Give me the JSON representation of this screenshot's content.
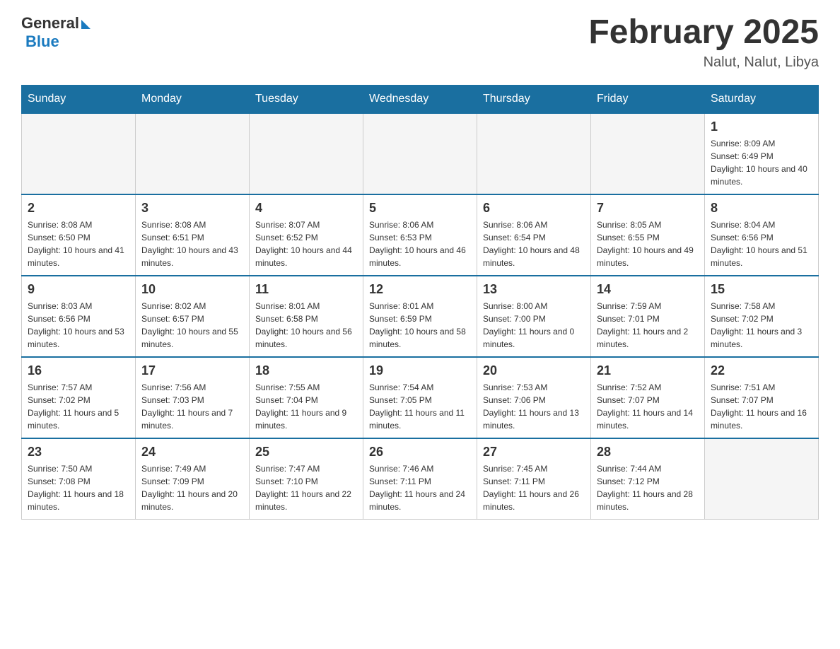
{
  "header": {
    "logo_general": "General",
    "logo_blue": "Blue",
    "month_title": "February 2025",
    "location": "Nalut, Nalut, Libya"
  },
  "weekdays": [
    "Sunday",
    "Monday",
    "Tuesday",
    "Wednesday",
    "Thursday",
    "Friday",
    "Saturday"
  ],
  "weeks": [
    [
      {
        "day": "",
        "sunrise": "",
        "sunset": "",
        "daylight": ""
      },
      {
        "day": "",
        "sunrise": "",
        "sunset": "",
        "daylight": ""
      },
      {
        "day": "",
        "sunrise": "",
        "sunset": "",
        "daylight": ""
      },
      {
        "day": "",
        "sunrise": "",
        "sunset": "",
        "daylight": ""
      },
      {
        "day": "",
        "sunrise": "",
        "sunset": "",
        "daylight": ""
      },
      {
        "day": "",
        "sunrise": "",
        "sunset": "",
        "daylight": ""
      },
      {
        "day": "1",
        "sunrise": "Sunrise: 8:09 AM",
        "sunset": "Sunset: 6:49 PM",
        "daylight": "Daylight: 10 hours and 40 minutes."
      }
    ],
    [
      {
        "day": "2",
        "sunrise": "Sunrise: 8:08 AM",
        "sunset": "Sunset: 6:50 PM",
        "daylight": "Daylight: 10 hours and 41 minutes."
      },
      {
        "day": "3",
        "sunrise": "Sunrise: 8:08 AM",
        "sunset": "Sunset: 6:51 PM",
        "daylight": "Daylight: 10 hours and 43 minutes."
      },
      {
        "day": "4",
        "sunrise": "Sunrise: 8:07 AM",
        "sunset": "Sunset: 6:52 PM",
        "daylight": "Daylight: 10 hours and 44 minutes."
      },
      {
        "day": "5",
        "sunrise": "Sunrise: 8:06 AM",
        "sunset": "Sunset: 6:53 PM",
        "daylight": "Daylight: 10 hours and 46 minutes."
      },
      {
        "day": "6",
        "sunrise": "Sunrise: 8:06 AM",
        "sunset": "Sunset: 6:54 PM",
        "daylight": "Daylight: 10 hours and 48 minutes."
      },
      {
        "day": "7",
        "sunrise": "Sunrise: 8:05 AM",
        "sunset": "Sunset: 6:55 PM",
        "daylight": "Daylight: 10 hours and 49 minutes."
      },
      {
        "day": "8",
        "sunrise": "Sunrise: 8:04 AM",
        "sunset": "Sunset: 6:56 PM",
        "daylight": "Daylight: 10 hours and 51 minutes."
      }
    ],
    [
      {
        "day": "9",
        "sunrise": "Sunrise: 8:03 AM",
        "sunset": "Sunset: 6:56 PM",
        "daylight": "Daylight: 10 hours and 53 minutes."
      },
      {
        "day": "10",
        "sunrise": "Sunrise: 8:02 AM",
        "sunset": "Sunset: 6:57 PM",
        "daylight": "Daylight: 10 hours and 55 minutes."
      },
      {
        "day": "11",
        "sunrise": "Sunrise: 8:01 AM",
        "sunset": "Sunset: 6:58 PM",
        "daylight": "Daylight: 10 hours and 56 minutes."
      },
      {
        "day": "12",
        "sunrise": "Sunrise: 8:01 AM",
        "sunset": "Sunset: 6:59 PM",
        "daylight": "Daylight: 10 hours and 58 minutes."
      },
      {
        "day": "13",
        "sunrise": "Sunrise: 8:00 AM",
        "sunset": "Sunset: 7:00 PM",
        "daylight": "Daylight: 11 hours and 0 minutes."
      },
      {
        "day": "14",
        "sunrise": "Sunrise: 7:59 AM",
        "sunset": "Sunset: 7:01 PM",
        "daylight": "Daylight: 11 hours and 2 minutes."
      },
      {
        "day": "15",
        "sunrise": "Sunrise: 7:58 AM",
        "sunset": "Sunset: 7:02 PM",
        "daylight": "Daylight: 11 hours and 3 minutes."
      }
    ],
    [
      {
        "day": "16",
        "sunrise": "Sunrise: 7:57 AM",
        "sunset": "Sunset: 7:02 PM",
        "daylight": "Daylight: 11 hours and 5 minutes."
      },
      {
        "day": "17",
        "sunrise": "Sunrise: 7:56 AM",
        "sunset": "Sunset: 7:03 PM",
        "daylight": "Daylight: 11 hours and 7 minutes."
      },
      {
        "day": "18",
        "sunrise": "Sunrise: 7:55 AM",
        "sunset": "Sunset: 7:04 PM",
        "daylight": "Daylight: 11 hours and 9 minutes."
      },
      {
        "day": "19",
        "sunrise": "Sunrise: 7:54 AM",
        "sunset": "Sunset: 7:05 PM",
        "daylight": "Daylight: 11 hours and 11 minutes."
      },
      {
        "day": "20",
        "sunrise": "Sunrise: 7:53 AM",
        "sunset": "Sunset: 7:06 PM",
        "daylight": "Daylight: 11 hours and 13 minutes."
      },
      {
        "day": "21",
        "sunrise": "Sunrise: 7:52 AM",
        "sunset": "Sunset: 7:07 PM",
        "daylight": "Daylight: 11 hours and 14 minutes."
      },
      {
        "day": "22",
        "sunrise": "Sunrise: 7:51 AM",
        "sunset": "Sunset: 7:07 PM",
        "daylight": "Daylight: 11 hours and 16 minutes."
      }
    ],
    [
      {
        "day": "23",
        "sunrise": "Sunrise: 7:50 AM",
        "sunset": "Sunset: 7:08 PM",
        "daylight": "Daylight: 11 hours and 18 minutes."
      },
      {
        "day": "24",
        "sunrise": "Sunrise: 7:49 AM",
        "sunset": "Sunset: 7:09 PM",
        "daylight": "Daylight: 11 hours and 20 minutes."
      },
      {
        "day": "25",
        "sunrise": "Sunrise: 7:47 AM",
        "sunset": "Sunset: 7:10 PM",
        "daylight": "Daylight: 11 hours and 22 minutes."
      },
      {
        "day": "26",
        "sunrise": "Sunrise: 7:46 AM",
        "sunset": "Sunset: 7:11 PM",
        "daylight": "Daylight: 11 hours and 24 minutes."
      },
      {
        "day": "27",
        "sunrise": "Sunrise: 7:45 AM",
        "sunset": "Sunset: 7:11 PM",
        "daylight": "Daylight: 11 hours and 26 minutes."
      },
      {
        "day": "28",
        "sunrise": "Sunrise: 7:44 AM",
        "sunset": "Sunset: 7:12 PM",
        "daylight": "Daylight: 11 hours and 28 minutes."
      },
      {
        "day": "",
        "sunrise": "",
        "sunset": "",
        "daylight": ""
      }
    ]
  ]
}
